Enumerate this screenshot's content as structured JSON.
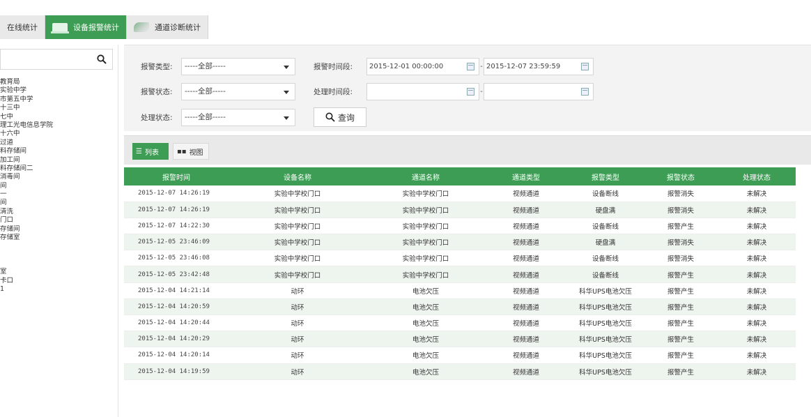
{
  "tabs": [
    {
      "label": "在线统计",
      "active": false
    },
    {
      "label": "设备报警统计",
      "active": true
    },
    {
      "label": "通道诊断统计",
      "active": false
    }
  ],
  "tree": {
    "search_placeholder": "",
    "items_top": [
      "教育局",
      "实验中学",
      "市第五中学",
      "十三中",
      "七中",
      "理工光电信息学院",
      "十六中",
      "过道",
      "料存储间",
      "加工间",
      "料存储间二",
      "消毒间",
      "间",
      "一",
      "间",
      "清洗",
      "门口",
      "存储间",
      "存储室"
    ],
    "selected_index": 0,
    "items_bottom": [
      "室",
      "卡口",
      "1"
    ]
  },
  "filters": {
    "alarm_type_label": "报警类型:",
    "alarm_type_value": "-----全部-----",
    "alarm_time_label": "报警时间段:",
    "alarm_time_start": "2015-12-01 00:00:00",
    "alarm_time_sep": "-",
    "alarm_time_end": "2015-12-07 23:59:59",
    "alarm_status_label": "报警状态:",
    "alarm_status_value": "-----全部-----",
    "handle_time_label": "处理时间段:",
    "handle_time_start": "",
    "handle_time_sep": "-",
    "handle_time_end": "",
    "handle_status_label": "处理状态:",
    "handle_status_value": "-----全部-----",
    "query_label": "查询"
  },
  "view": {
    "list_label": "列表",
    "view_label": "视图"
  },
  "table": {
    "headers": [
      "报警时间",
      "设备名称",
      "通道名称",
      "通道类型",
      "报警类型",
      "报警状态",
      "处理状态"
    ],
    "rows": [
      [
        "2015-12-07 14:26:19",
        "实验中学校门口",
        "实验中学校门口",
        "视频通道",
        "设备断线",
        "报警消失",
        "未解决"
      ],
      [
        "2015-12-07 14:26:19",
        "实验中学校门口",
        "实验中学校门口",
        "视频通道",
        "硬盘满",
        "报警消失",
        "未解决"
      ],
      [
        "2015-12-07 14:22:30",
        "实验中学校门口",
        "实验中学校门口",
        "视频通道",
        "设备断线",
        "报警产生",
        "未解决"
      ],
      [
        "2015-12-05 23:46:09",
        "实验中学校门口",
        "实验中学校门口",
        "视频通道",
        "硬盘满",
        "报警消失",
        "未解决"
      ],
      [
        "2015-12-05 23:46:08",
        "实验中学校门口",
        "实验中学校门口",
        "视频通道",
        "设备断线",
        "报警消失",
        "未解决"
      ],
      [
        "2015-12-05 23:42:48",
        "实验中学校门口",
        "实验中学校门口",
        "视频通道",
        "设备断线",
        "报警产生",
        "未解决"
      ],
      [
        "2015-12-04 14:21:14",
        "动环",
        "电池欠压",
        "视频通道",
        "科华UPS电池欠压",
        "报警产生",
        "未解决"
      ],
      [
        "2015-12-04 14:20:59",
        "动环",
        "电池欠压",
        "视频通道",
        "科华UPS电池欠压",
        "报警产生",
        "未解决"
      ],
      [
        "2015-12-04 14:20:44",
        "动环",
        "电池欠压",
        "视频通道",
        "科华UPS电池欠压",
        "报警产生",
        "未解决"
      ],
      [
        "2015-12-04 14:20:29",
        "动环",
        "电池欠压",
        "视频通道",
        "科华UPS电池欠压",
        "报警产生",
        "未解决"
      ],
      [
        "2015-12-04 14:20:14",
        "动环",
        "电池欠压",
        "视频通道",
        "科华UPS电池欠压",
        "报警产生",
        "未解决"
      ],
      [
        "2015-12-04 14:19:59",
        "动环",
        "电池欠压",
        "视频通道",
        "科华UPS电池欠压",
        "报警产生",
        "未解决"
      ]
    ]
  },
  "colors": {
    "accent_green": "#3e9d55",
    "selected_tree_bg": "#fbe9c8",
    "alt_row_bg": "#eef4ee"
  }
}
